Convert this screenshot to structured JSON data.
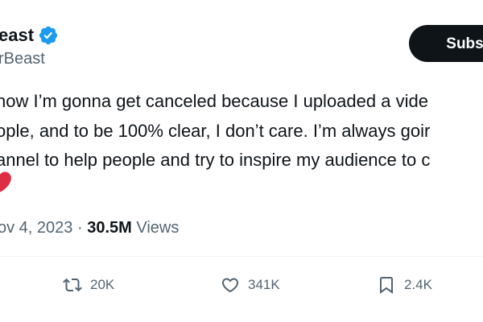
{
  "tweet": {
    "display_name": "east",
    "handle": "rBeast",
    "subscribe_label": "Subscr",
    "text_lines": [
      "now I’m gonna get canceled because I uploaded a vide",
      "ople, and to be 100% clear, I don’t care. I’m always goir",
      "annel to help people and try to inspire my audience to c"
    ],
    "date": "ov 4, 2023",
    "separator": "·",
    "views_count": "30.5M",
    "views_label": "Views",
    "actions": {
      "retweets": "20K",
      "likes": "341K",
      "bookmarks": "2.4K"
    }
  },
  "colors": {
    "verified": "#1d9bf0",
    "text_primary": "#0f1419",
    "text_secondary": "#536471",
    "heart": "#e0245e",
    "button_bg": "#0f1419"
  },
  "icons": {
    "verified": "verified-badge-icon",
    "heart_emoji": "red-heart-emoji",
    "retweet": "retweet-icon",
    "like": "heart-outline-icon",
    "bookmark": "bookmark-icon"
  }
}
